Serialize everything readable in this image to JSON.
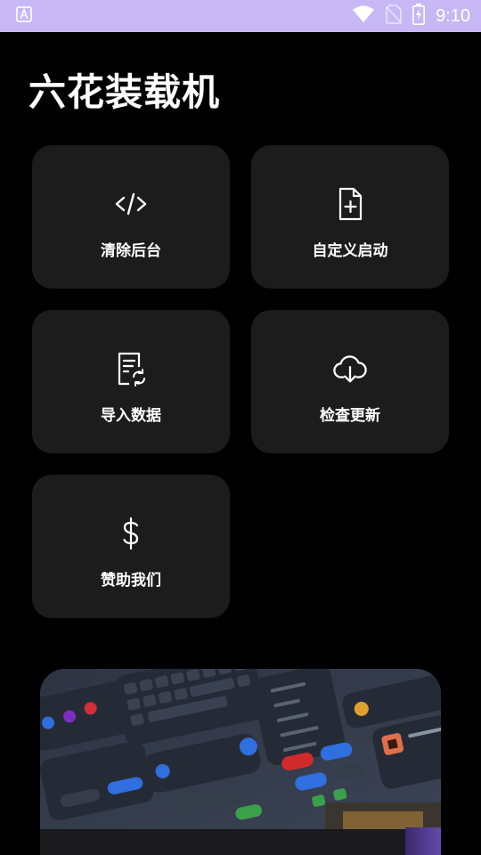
{
  "status_bar": {
    "time": "9:10",
    "icons": [
      "app-notification-icon",
      "wifi-icon",
      "no-sim-icon",
      "battery-charging-icon"
    ]
  },
  "app": {
    "title": "六花装载机"
  },
  "cards": [
    {
      "label": "清除后台",
      "icon": "code-icon"
    },
    {
      "label": "自定义启动",
      "icon": "file-add-icon"
    },
    {
      "label": "导入数据",
      "icon": "document-sync-icon"
    },
    {
      "label": "检查更新",
      "icon": "cloud-download-icon"
    },
    {
      "label": "赞助我们",
      "icon": "dollar-icon"
    }
  ],
  "banner": {
    "description_icon": "ui-components-collage-image"
  },
  "colors": {
    "status_bar": "#c7b8f5",
    "background": "#000000",
    "card": "#1c1c1c"
  }
}
